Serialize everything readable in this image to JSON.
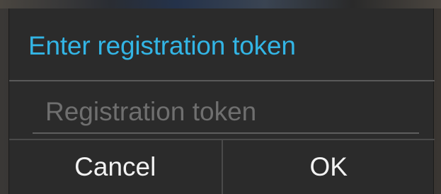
{
  "dialog": {
    "title": "Enter registration token",
    "input": {
      "value": "",
      "placeholder": "Registration token"
    },
    "buttons": {
      "cancel_label": "Cancel",
      "ok_label": "OK"
    }
  },
  "colors": {
    "accent": "#33b5e5",
    "dialog_background": "#2b2b2b",
    "divider": "#5a5a5a",
    "placeholder": "#6f6f6f",
    "button_text": "#f2f2f2"
  }
}
